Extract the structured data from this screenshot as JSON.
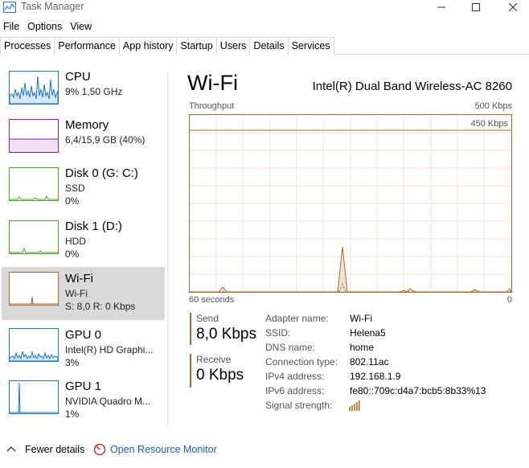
{
  "window": {
    "title": "Task Manager"
  },
  "menu": [
    "File",
    "Options",
    "View"
  ],
  "tabs": [
    "Processes",
    "Performance",
    "App history",
    "Startup",
    "Users",
    "Details",
    "Services"
  ],
  "active_tab": "Performance",
  "sidebar": {
    "items": [
      {
        "title": "CPU",
        "line1": "9% 1,50 GHz",
        "line2": "",
        "color": "#1f76bd"
      },
      {
        "title": "Memory",
        "line1": "6,4/15,9 GB (40%)",
        "line2": "",
        "color": "#8b1ea5"
      },
      {
        "title": "Disk 0 (G: C:)",
        "line1": "SSD",
        "line2": "0%",
        "color": "#4da22a"
      },
      {
        "title": "Disk 1 (D:)",
        "line1": "HDD",
        "line2": "0%",
        "color": "#4da22a"
      },
      {
        "title": "Wi-Fi",
        "line1": "Wi-Fi",
        "line2": "S: 8,0 R: 0 Kbps",
        "color": "#a8672c"
      },
      {
        "title": "GPU 0",
        "line1": "Intel(R) HD Graphi...",
        "line2": "3%",
        "color": "#1f76bd"
      },
      {
        "title": "GPU 1",
        "line1": "NVIDIA Quadro M...",
        "line2": "1%",
        "color": "#1f76bd"
      }
    ]
  },
  "main": {
    "title": "Wi-Fi",
    "adapter": "Intel(R) Dual Band Wireless-AC 8260",
    "throughput_label": "Throughput",
    "max_label": "500 Kbps",
    "scale_label": "450 Kbps",
    "time_label": "60 seconds",
    "zero_label": "0",
    "accent": "#a8672c",
    "send": {
      "label": "Send",
      "value": "8,0 Kbps"
    },
    "receive": {
      "label": "Receive",
      "value": "0 Kbps"
    },
    "properties": [
      {
        "key": "Adapter name:",
        "value": "Wi-Fi"
      },
      {
        "key": "SSID:",
        "value": "Helena5"
      },
      {
        "key": "DNS name:",
        "value": "home"
      },
      {
        "key": "Connection type:",
        "value": "802.11ac"
      },
      {
        "key": "IPv4 address:",
        "value": "192.168.1.9"
      },
      {
        "key": "IPv6 address:",
        "value": "fe80::709c:d4a7:bcb5:8b33%13"
      },
      {
        "key": "Signal strength:",
        "value": ""
      }
    ],
    "signal_icon": "signal-bars-icon"
  },
  "footer": {
    "fewer_details": "Fewer details",
    "open_resource_monitor": "Open Resource Monitor"
  }
}
